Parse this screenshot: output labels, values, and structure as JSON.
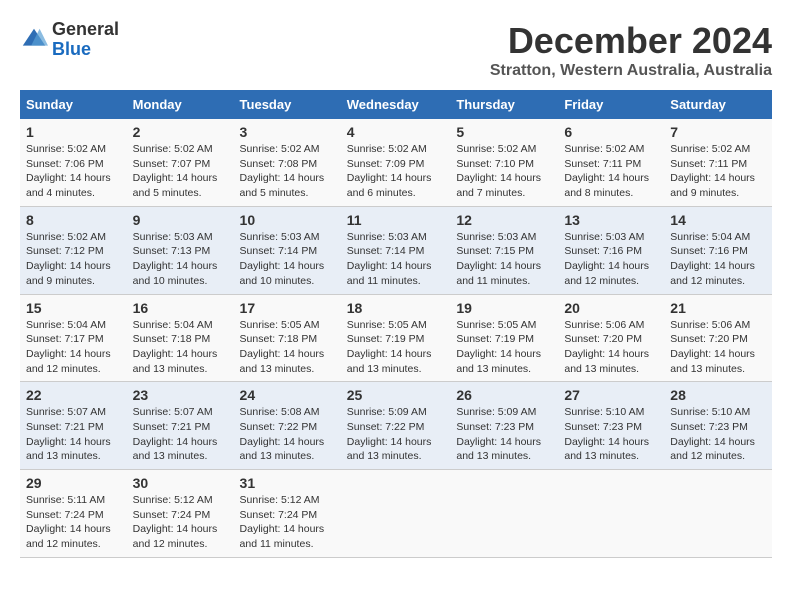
{
  "logo": {
    "general": "General",
    "blue": "Blue"
  },
  "title": "December 2024",
  "subtitle": "Stratton, Western Australia, Australia",
  "headers": [
    "Sunday",
    "Monday",
    "Tuesday",
    "Wednesday",
    "Thursday",
    "Friday",
    "Saturday"
  ],
  "weeks": [
    [
      {
        "day": "1",
        "sunrise": "5:02 AM",
        "sunset": "7:06 PM",
        "daylight": "14 hours and 4 minutes."
      },
      {
        "day": "2",
        "sunrise": "5:02 AM",
        "sunset": "7:07 PM",
        "daylight": "14 hours and 5 minutes."
      },
      {
        "day": "3",
        "sunrise": "5:02 AM",
        "sunset": "7:08 PM",
        "daylight": "14 hours and 5 minutes."
      },
      {
        "day": "4",
        "sunrise": "5:02 AM",
        "sunset": "7:09 PM",
        "daylight": "14 hours and 6 minutes."
      },
      {
        "day": "5",
        "sunrise": "5:02 AM",
        "sunset": "7:10 PM",
        "daylight": "14 hours and 7 minutes."
      },
      {
        "day": "6",
        "sunrise": "5:02 AM",
        "sunset": "7:11 PM",
        "daylight": "14 hours and 8 minutes."
      },
      {
        "day": "7",
        "sunrise": "5:02 AM",
        "sunset": "7:11 PM",
        "daylight": "14 hours and 9 minutes."
      }
    ],
    [
      {
        "day": "8",
        "sunrise": "5:02 AM",
        "sunset": "7:12 PM",
        "daylight": "14 hours and 9 minutes."
      },
      {
        "day": "9",
        "sunrise": "5:03 AM",
        "sunset": "7:13 PM",
        "daylight": "14 hours and 10 minutes."
      },
      {
        "day": "10",
        "sunrise": "5:03 AM",
        "sunset": "7:14 PM",
        "daylight": "14 hours and 10 minutes."
      },
      {
        "day": "11",
        "sunrise": "5:03 AM",
        "sunset": "7:14 PM",
        "daylight": "14 hours and 11 minutes."
      },
      {
        "day": "12",
        "sunrise": "5:03 AM",
        "sunset": "7:15 PM",
        "daylight": "14 hours and 11 minutes."
      },
      {
        "day": "13",
        "sunrise": "5:03 AM",
        "sunset": "7:16 PM",
        "daylight": "14 hours and 12 minutes."
      },
      {
        "day": "14",
        "sunrise": "5:04 AM",
        "sunset": "7:16 PM",
        "daylight": "14 hours and 12 minutes."
      }
    ],
    [
      {
        "day": "15",
        "sunrise": "5:04 AM",
        "sunset": "7:17 PM",
        "daylight": "14 hours and 12 minutes."
      },
      {
        "day": "16",
        "sunrise": "5:04 AM",
        "sunset": "7:18 PM",
        "daylight": "14 hours and 13 minutes."
      },
      {
        "day": "17",
        "sunrise": "5:05 AM",
        "sunset": "7:18 PM",
        "daylight": "14 hours and 13 minutes."
      },
      {
        "day": "18",
        "sunrise": "5:05 AM",
        "sunset": "7:19 PM",
        "daylight": "14 hours and 13 minutes."
      },
      {
        "day": "19",
        "sunrise": "5:05 AM",
        "sunset": "7:19 PM",
        "daylight": "14 hours and 13 minutes."
      },
      {
        "day": "20",
        "sunrise": "5:06 AM",
        "sunset": "7:20 PM",
        "daylight": "14 hours and 13 minutes."
      },
      {
        "day": "21",
        "sunrise": "5:06 AM",
        "sunset": "7:20 PM",
        "daylight": "14 hours and 13 minutes."
      }
    ],
    [
      {
        "day": "22",
        "sunrise": "5:07 AM",
        "sunset": "7:21 PM",
        "daylight": "14 hours and 13 minutes."
      },
      {
        "day": "23",
        "sunrise": "5:07 AM",
        "sunset": "7:21 PM",
        "daylight": "14 hours and 13 minutes."
      },
      {
        "day": "24",
        "sunrise": "5:08 AM",
        "sunset": "7:22 PM",
        "daylight": "14 hours and 13 minutes."
      },
      {
        "day": "25",
        "sunrise": "5:09 AM",
        "sunset": "7:22 PM",
        "daylight": "14 hours and 13 minutes."
      },
      {
        "day": "26",
        "sunrise": "5:09 AM",
        "sunset": "7:23 PM",
        "daylight": "14 hours and 13 minutes."
      },
      {
        "day": "27",
        "sunrise": "5:10 AM",
        "sunset": "7:23 PM",
        "daylight": "14 hours and 13 minutes."
      },
      {
        "day": "28",
        "sunrise": "5:10 AM",
        "sunset": "7:23 PM",
        "daylight": "14 hours and 12 minutes."
      }
    ],
    [
      {
        "day": "29",
        "sunrise": "5:11 AM",
        "sunset": "7:24 PM",
        "daylight": "14 hours and 12 minutes."
      },
      {
        "day": "30",
        "sunrise": "5:12 AM",
        "sunset": "7:24 PM",
        "daylight": "14 hours and 12 minutes."
      },
      {
        "day": "31",
        "sunrise": "5:12 AM",
        "sunset": "7:24 PM",
        "daylight": "14 hours and 11 minutes."
      },
      null,
      null,
      null,
      null
    ]
  ],
  "labels": {
    "sunrise": "Sunrise:",
    "sunset": "Sunset:",
    "daylight": "Daylight:"
  }
}
